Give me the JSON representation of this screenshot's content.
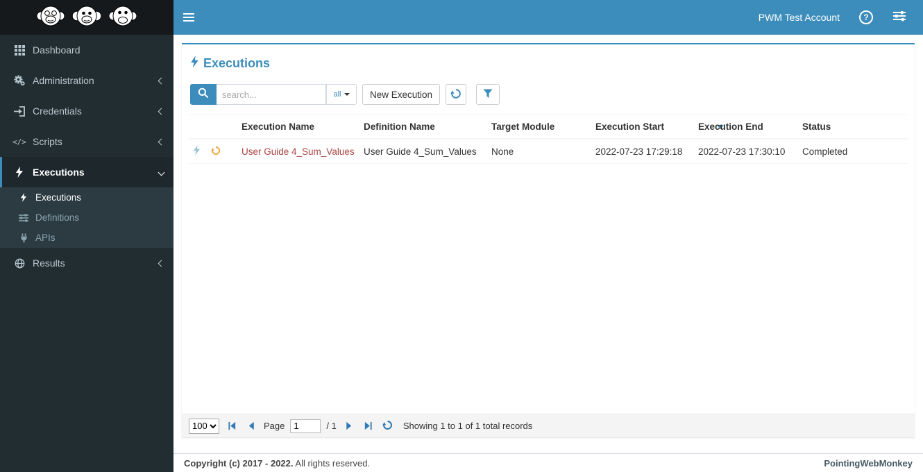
{
  "topbar": {
    "account": "PWM Test Account"
  },
  "sidebar": {
    "items": [
      {
        "label": "Dashboard"
      },
      {
        "label": "Administration"
      },
      {
        "label": "Credentials"
      },
      {
        "label": "Scripts"
      },
      {
        "label": "Executions"
      },
      {
        "label": "Results"
      }
    ],
    "executions_submenu": [
      {
        "label": "Executions"
      },
      {
        "label": "Definitions"
      },
      {
        "label": "APIs"
      }
    ]
  },
  "main": {
    "title": "Executions",
    "search": {
      "placeholder": "search...",
      "scope": "all"
    },
    "toolbar": {
      "new_execution": "New Execution"
    },
    "table": {
      "columns": [
        "Execution Name",
        "Definition Name",
        "Target Module",
        "Execution Start",
        "Execution End",
        "Status"
      ],
      "sorted_column": "Execution Start",
      "sort_direction": "desc",
      "rows": [
        {
          "execution_name": "User Guide 4_Sum_Values",
          "definition_name": "User Guide 4_Sum_Values",
          "target_module": "None",
          "execution_start": "2022-07-23 17:29:18",
          "execution_end": "2022-07-23 17:30:10",
          "status": "Completed"
        }
      ]
    },
    "pagination": {
      "page_size": "100",
      "page_label": "Page",
      "page_value": "1",
      "total_pages": "/ 1",
      "summary": "Showing 1 to 1 of 1 total records"
    }
  },
  "footer": {
    "copyright_strong": "Copyright (c) 2017 - 2022.",
    "copyright_rest": "All rights reserved.",
    "brand": "PointingWebMonkey"
  },
  "colors": {
    "accent": "#3c8dbc",
    "sidebar_bg": "#222d32",
    "link": "#a94442",
    "row_refresh_icon": "#f0ad4e",
    "row_bolt_icon": "#9dc3d4"
  }
}
